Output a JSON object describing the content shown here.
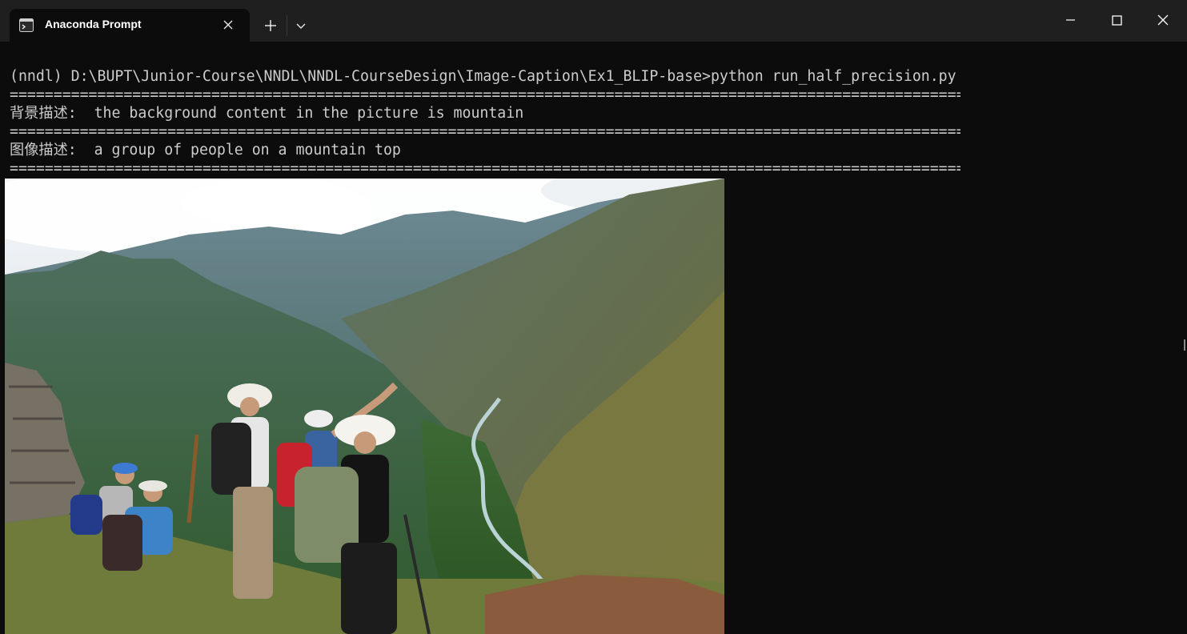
{
  "window": {
    "tab_title": "Anaconda Prompt",
    "icons": {
      "tab": "terminal-icon",
      "close_tab": "close-icon",
      "new_tab": "plus-icon",
      "dropdown": "chevron-down-icon",
      "minimize": "minimize-icon",
      "maximize": "maximize-icon",
      "close_window": "close-icon"
    }
  },
  "terminal": {
    "lines": [
      "(nndl) D:\\BUPT\\Junior-Course\\NNDL\\NNDL-CourseDesign\\Image-Caption\\Ex1_BLIP-base>python run_half_precision.py",
      "=======================================================================================================================================================",
      "背景描述:  the background content in the picture is mountain",
      "=======================================================================================================================================================",
      "图像描述:  a group of people on a mountain top",
      "======================================================================================================================================================="
    ],
    "colors": {
      "background": "#0c0c0c",
      "text": "#cccccc",
      "titlebar": "#1f1f1f"
    }
  }
}
